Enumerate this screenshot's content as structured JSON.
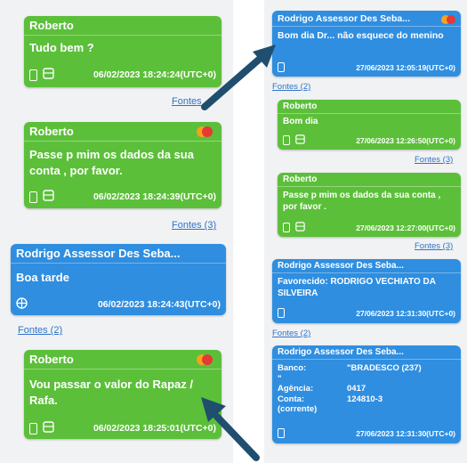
{
  "left_panel": {
    "messages": [
      {
        "sender": "Roberto",
        "text": "Tudo bem ?",
        "timestamp": "06/02/2023 18:24:24(UTC+0)",
        "color": "#5cbf3a"
      },
      {
        "sender": "Roberto",
        "text": "Passe p mim os dados da sua conta , por favor.",
        "timestamp": "06/02/2023 18:24:39(UTC+0)",
        "fontes": "Fontes (3)",
        "color": "#5cbf3a"
      },
      {
        "sender": "Rodrigo Assessor Des Seba...",
        "text": "Boa tarde",
        "timestamp": "06/02/2023 18:24:43(UTC+0)",
        "fontes": "Fontes (2)",
        "color": "#2f8ee0"
      },
      {
        "sender": "Roberto",
        "text": "Vou passar o valor do Rapaz / Rafa.",
        "timestamp": "06/02/2023 18:25:01(UTC+0)",
        "color": "#5cbf3a"
      }
    ],
    "partial_fontes": "Fontes"
  },
  "right_panel": {
    "messages": [
      {
        "sender": "Rodrigo Assessor Des Seba...",
        "text": "Bom dia Dr... não esquece do menino",
        "timestamp": "27/06/2023 12:05:19(UTC+0)",
        "fontes": "Fontes (2)",
        "color": "#2f8ee0"
      },
      {
        "sender": "Roberto",
        "text": "Bom dia",
        "timestamp": "27/06/2023 12:26:50(UTC+0)",
        "fontes": "Fontes (3)",
        "color": "#5cbf3a"
      },
      {
        "sender": "Roberto",
        "text": "Passe p mim os dados da sua conta , por favor .",
        "timestamp": "27/06/2023 12:27:00(UTC+0)",
        "fontes": "Fontes (3)",
        "color": "#5cbf3a"
      },
      {
        "sender": "Rodrigo Assessor Des Seba...",
        "text": "Favorecido: RODRIGO VECHIATO DA SILVEIRA",
        "timestamp": "27/06/2023 12:31:30(UTC+0)",
        "fontes": "Fontes (2)",
        "color": "#2f8ee0"
      },
      {
        "sender": "Rodrigo Assessor Des Seba...",
        "timestamp": "27/06/2023 12:31:30(UTC+0)",
        "color": "#2f8ee0",
        "details": [
          {
            "label": "Banco:",
            "value": "\"BRADESCO (237)"
          },
          {
            "label": "\"",
            "value": ""
          },
          {
            "label": "Agência:",
            "value": "0417"
          },
          {
            "label": "Conta:",
            "value": "124810-3"
          },
          {
            "label": "(corrente)",
            "value": ""
          }
        ]
      }
    ]
  },
  "icons": {
    "phone": "phone-icon",
    "message": "message-icon",
    "globe": "globe-icon",
    "flag": "flag-icon",
    "arrow": "pointer-arrow"
  },
  "colors": {
    "green_bubble": "#5cbf3a",
    "blue_bubble": "#2f8ee0",
    "link": "#2f74c9",
    "arrow": "#1f4e6e",
    "flag_red": "#e53935",
    "flag_orange": "#f7a21b"
  }
}
